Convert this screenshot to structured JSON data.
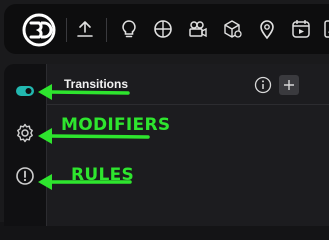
{
  "toolbar": {
    "logo_icon": "3d-logo-icon",
    "buttons": [
      {
        "icon": "upload-icon"
      },
      {
        "icon": "lightbulb-icon"
      },
      {
        "icon": "sphere-icon"
      },
      {
        "icon": "camera-icon"
      },
      {
        "icon": "cube-settings-icon"
      },
      {
        "icon": "location-pin-icon"
      },
      {
        "icon": "video-calendar-icon"
      },
      {
        "icon": "text-box-icon"
      }
    ]
  },
  "sidebar": {
    "items": [
      {
        "name": "transitions",
        "icon": "transitions-toggle-icon",
        "active": true
      },
      {
        "name": "modifiers",
        "icon": "gear-icon",
        "active": false
      },
      {
        "name": "rules",
        "icon": "alert-circle-icon",
        "active": false
      }
    ]
  },
  "panel": {
    "title": "Transitions",
    "info_icon": "info-icon",
    "add_icon": "plus-icon"
  },
  "annotations": {
    "modifiers_label": "MODIFIERS",
    "rules_label": "RULES",
    "color": "#2ee52e"
  },
  "colors": {
    "accent": "#22b8b0",
    "background": "#1c1c1f",
    "toolbar_bg": "#0d0d0e"
  }
}
